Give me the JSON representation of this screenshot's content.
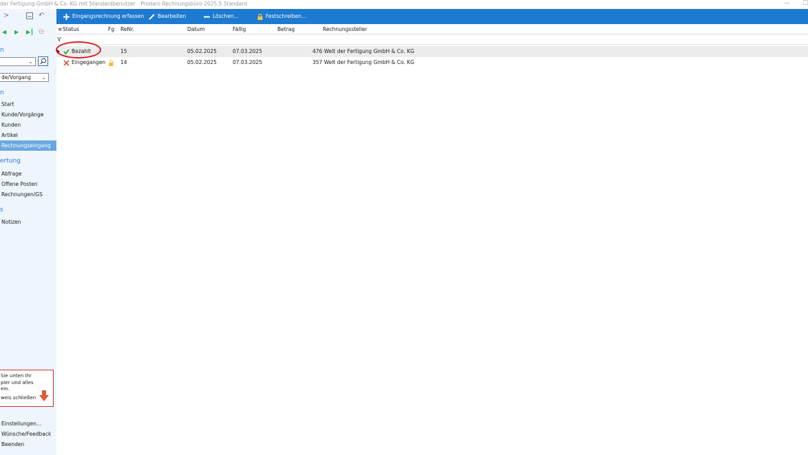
{
  "window": {
    "title": "der Fertigung GmbH & Co. KG mit Standardbenutzer  -  Prodaro Rechnungsbüro 2025.5 Standard",
    "minimize": "—",
    "maximize": "☐"
  },
  "sidebar": {
    "section1_head": "n",
    "search_value": "",
    "mode_combo": "de/Vorgang",
    "section2_head": "n",
    "nav_items": [
      {
        "label": "Start"
      },
      {
        "label": "Kunde/Vorgänge"
      },
      {
        "label": "Kunden"
      },
      {
        "label": "Artikel"
      },
      {
        "label": "Rechnungseingang"
      }
    ],
    "section3_head": "ertung",
    "eval_items": [
      {
        "label": "Abfrage"
      },
      {
        "label": "Offene Posten"
      },
      {
        "label": "Rechnungen/GS"
      }
    ],
    "section4_head": "s",
    "extra_items": [
      {
        "label": "Notizen"
      }
    ],
    "hint": {
      "line1": "Sie unten Ihr",
      "line2": "pier und alles",
      "line3": "ein.",
      "close": "weis schließen"
    },
    "bottom_items": [
      {
        "label": "Einstellungen..."
      },
      {
        "label": "Wünsche/Feedback"
      },
      {
        "label": "Beenden"
      }
    ]
  },
  "toolbar": {
    "add_label": "Eingangsrechnung erfassen",
    "edit_label": "Bearbeiten",
    "delete_label": "Löschen...",
    "lock_label": "Festschreiben..."
  },
  "table": {
    "columns": {
      "status": "Status",
      "fg": "Fg",
      "renr": "ReNr.",
      "datum": "Datum",
      "faellig": "Fällig",
      "betrag": "Betrag",
      "steller": "Rechnungssteller"
    },
    "rows": [
      {
        "status": "Bezahlt",
        "fg": "",
        "renr": "15",
        "datum": "05.02.2025",
        "faellig": "07.03.2025",
        "steller": "476 Welt der Fertigung GmbH & Co. KG"
      },
      {
        "status": "Eingegangen",
        "fg": "locked",
        "renr": "14",
        "datum": "05.02.2025",
        "faellig": "07.03.2025",
        "steller": "357 Welt der Fertigung GmbH & Co. KG"
      }
    ]
  },
  "colors": {
    "toolbar": "#1e7ad0",
    "sidebar_bg": "#eef5fc",
    "active_nav": "#6aa8e0",
    "highlight_circle": "#d42020",
    "paid_check": "#2eaa3c",
    "cancel_x": "#e05a3a"
  }
}
